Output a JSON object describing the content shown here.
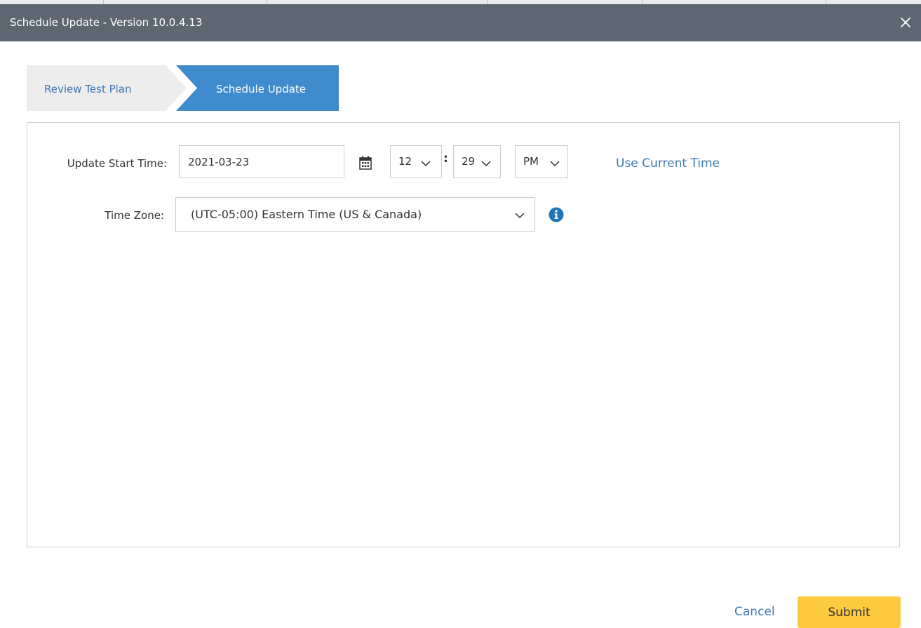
{
  "dialog": {
    "title": "Schedule Update - Version 10.0.4.13",
    "close_icon": "close-icon"
  },
  "wizard": {
    "steps": [
      {
        "label": "Review Test Plan",
        "active": false
      },
      {
        "label": "Schedule Update",
        "active": true
      }
    ]
  },
  "form": {
    "start_time": {
      "label": "Update Start Time:",
      "date_value": "2021-03-23",
      "calendar_icon": "calendar-icon",
      "hour": "12",
      "minute": "29",
      "separator": ":",
      "ampm": "PM",
      "use_current_label": "Use Current Time"
    },
    "time_zone": {
      "label": "Time Zone:",
      "value": "(UTC-05:00) Eastern Time (US & Canada)",
      "info_icon": "info-icon"
    }
  },
  "footer": {
    "cancel_label": "Cancel",
    "submit_label": "Submit"
  },
  "colors": {
    "titlebar": "#5c6772",
    "active_step": "#3f8bcc",
    "inactive_step": "#ededed",
    "link": "#3b77b5",
    "submit": "#fcc93f"
  }
}
